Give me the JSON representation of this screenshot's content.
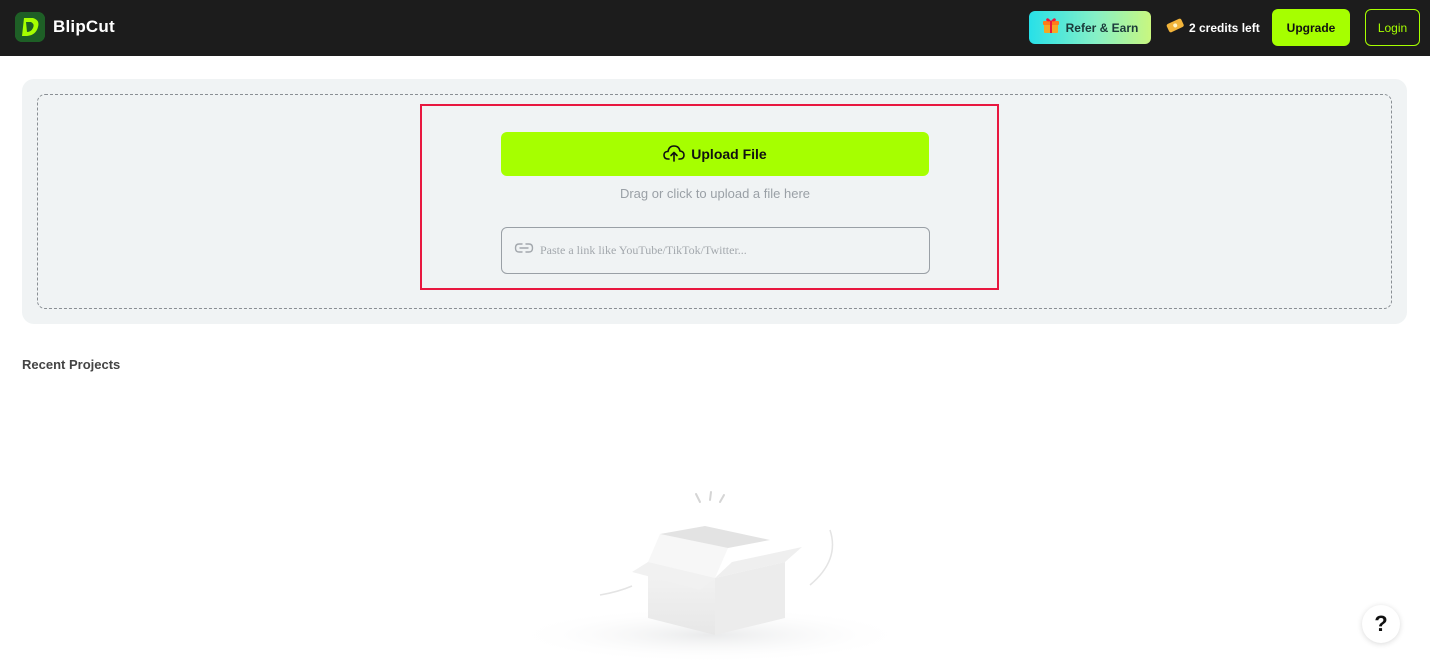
{
  "header": {
    "brand_name": "BlipCut",
    "refer_label": "Refer & Earn",
    "credits_label": "2 credits left",
    "upgrade_label": "Upgrade",
    "login_label": "Login"
  },
  "upload": {
    "button_label": "Upload File",
    "drag_hint": "Drag or click to upload a file here",
    "link_placeholder": "Paste a link like YouTube/TikTok/Twitter...",
    "link_value": ""
  },
  "recent": {
    "title": "Recent Projects"
  },
  "help": {
    "label": "?"
  },
  "icons": {
    "logo": "blipcut-logo-icon",
    "refer": "gift-icon",
    "credits": "ticket-icon",
    "upload": "cloud-upload-icon",
    "link": "link-icon",
    "empty": "empty-box-icon"
  },
  "colors": {
    "accent": "#a6ff00",
    "topbar": "#1c1c1c",
    "highlight": "#e8173f",
    "panel": "#f0f3f4"
  }
}
